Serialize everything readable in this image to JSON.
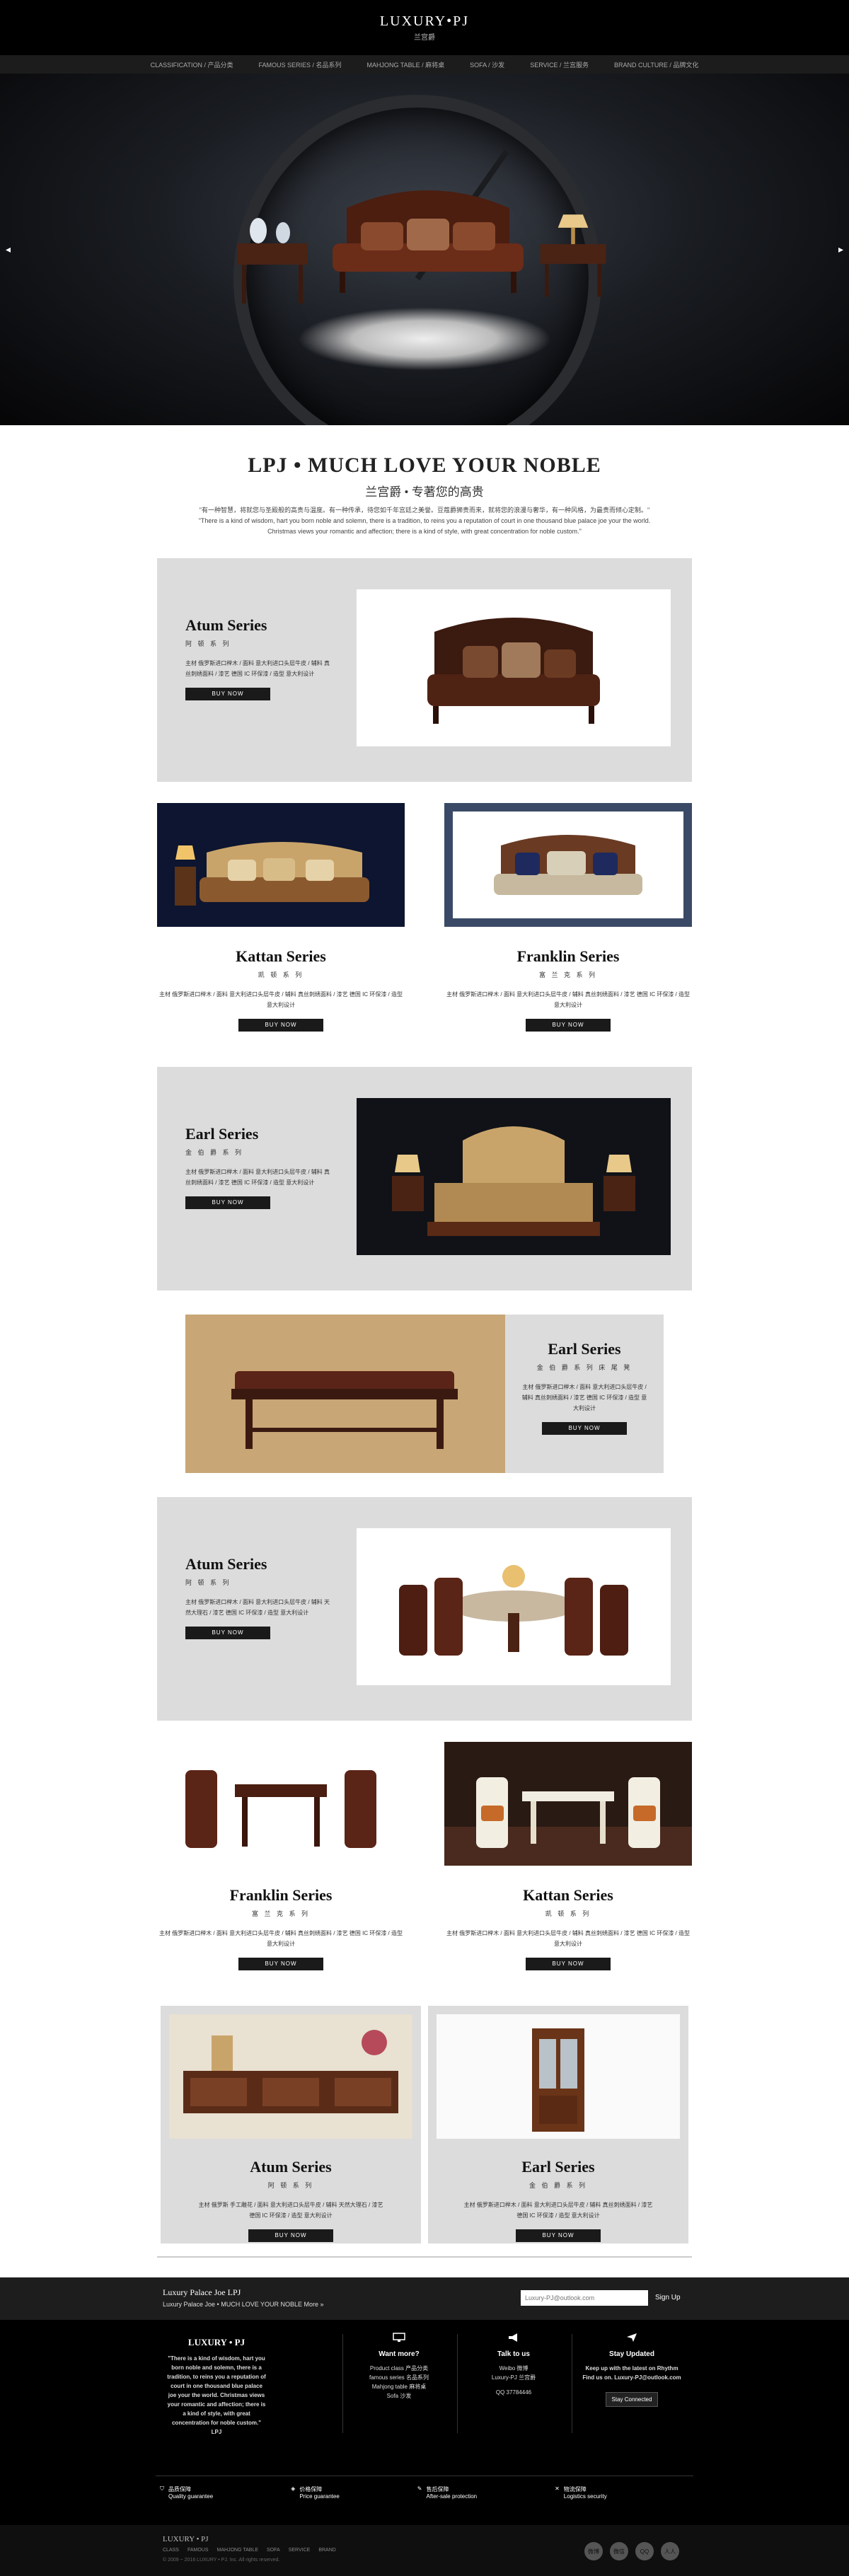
{
  "header": {
    "logo": "LUXURY•PJ",
    "logo_sub": "兰宫爵"
  },
  "nav": [
    "CLASSIFICATION / 产品分类",
    "FAMOUS SERIES / 名品系列",
    "MAHJONG TABLE / 麻将桌",
    "SOFA / 沙发",
    "SERVICE / 兰宫服务",
    "BRAND CULTURE / 品牌文化"
  ],
  "hero": {
    "prev": "◂",
    "next": "▸"
  },
  "intro": {
    "title": "LPJ • MUCH LOVE YOUR NOBLE",
    "subtitle": "兰宫爵 • 专著您的高贵",
    "line1": "\"有一种智慧，将就您与圣殿般的高贵与温度。有一种传承，待您如千年宫廷之美誉。豆蔻爵狮贵而来，就将您的浪漫与奢华，有一种风格，为最贵而倾心定制。\"",
    "line2": "\"There is a kind of wisdom, hart you born noble and solemn, there is a tradition, to reins you a reputation of court in one thousand blue palace joe your the world.",
    "line3": "Christmas views your romantic and affection; there is a kind of style, with great concentration for noble custom.\""
  },
  "series": {
    "s1": {
      "title": "Atum Series",
      "sub": "阿 顿 系 列",
      "desc": "主材 俄罗斯进口榉木 / 面料 意大利进口头层牛皮 / 辅料 真 丝刺绣面料 / 漆艺 德国 IC 环保漆 / 造型 意大利设计",
      "buy": "BUY NOW"
    },
    "s2": {
      "title": "Kattan Series",
      "sub": "凯 顿 系 列",
      "desc": "主材 俄罗斯进口榉木 / 面料 意大利进口头层牛皮 / 辅料 真丝刺绣面料 / 漆艺 德国 IC 环保漆 / 造型 意大利设计",
      "buy": "BUY NOW"
    },
    "s3": {
      "title": "Franklin Series",
      "sub": "富 兰 克 系 列",
      "desc": "主材 俄罗斯进口榉木 / 面料 意大利进口头层牛皮 / 辅料 真丝刺绣面料 / 漆艺 德国 IC 环保漆 / 造型 意大利设计",
      "buy": "BUY NOW"
    },
    "s4": {
      "title": "Earl Series",
      "sub": "金 伯 爵 系 列",
      "desc": "主材 俄罗斯进口榉木 / 面料 意大利进口头层牛皮 / 辅料 真 丝刺绣面料 / 漆艺 德国 IC 环保漆 / 造型 意大利设计",
      "buy": "BUY NOW"
    },
    "s5": {
      "title": "Earl Series",
      "sub": "金 伯 爵 系 列 床 尾 凳",
      "desc": "主材 俄罗斯进口榉木 / 面料 意大利进口头层牛皮 / 辅料 真丝刺绣面料 / 漆艺 德国 IC 环保漆 / 造型 意大利设计",
      "buy": "BUY NOW"
    },
    "s6": {
      "title": "Atum Series",
      "sub": "阿 顿 系 列",
      "desc": "主材 俄罗斯进口榉木 / 面料 意大利进口头层牛皮 / 辅料 天 然大理石 / 漆艺 德国 IC 环保漆 / 造型 意大利设计",
      "buy": "BUY NOW"
    },
    "s7": {
      "title": "Franklin Series",
      "sub": "富 兰 克 系 列",
      "desc": "主材 俄罗斯进口榉木 / 面料 意大利进口头层牛皮 / 辅料 真丝刺绣面料 / 漆艺 德国 IC 环保漆 / 造型 意大利设计",
      "buy": "BUY NOW"
    },
    "s8": {
      "title": "Kattan Series",
      "sub": "凯 顿 系 列",
      "desc": "主材 俄罗斯进口榉木 / 面料 意大利进口头层牛皮 / 辅料 真丝刺绣面料 / 漆艺 德国 IC 环保漆 / 造型 意大利设计",
      "buy": "BUY NOW"
    },
    "s9": {
      "title": "Atum Series",
      "sub": "阿 顿 系 列",
      "desc": "主材 俄罗斯 手工雕花 / 面料 意大利进口头层牛皮 / 辅料 天然大理石 / 漆艺 德国 IC 环保漆 / 造型 意大利设计",
      "buy": "BUY NOW"
    },
    "s10": {
      "title": "Earl Series",
      "sub": "金 伯 爵 系 列",
      "desc": "主材 俄罗斯进口榉木 / 面料 意大利进口头层牛皮 / 辅料 真丝刺绣面料 / 漆艺 德国 IC 环保漆 / 造型 意大利设计",
      "buy": "BUY NOW"
    }
  },
  "subscribe": {
    "title": "Luxury Palace Joe LPJ",
    "text": "Luxury Palace Joe • MUCH LOVE YOUR NOBLE  More »",
    "placeholder": "Luxury-PJ@outlook.com",
    "button": "Sign Up"
  },
  "footer": {
    "brand": {
      "title": "LUXURY • PJ",
      "text": "\"There is a kind of wisdom, hart you born noble and solemn, there is a tradition, to reins you a reputation of court in one thousand blue palace joe your the world. Christmas views your romantic and affection; there is a kind of style, with great concentration for noble custom.\" LPJ"
    },
    "want": {
      "title": "Want more?",
      "l1": "Product class 产品分类",
      "l2": "famous series 名品系列",
      "l3": "Mahjong table 麻将桌",
      "l4": "Sofa 沙发"
    },
    "talk": {
      "title": "Talk to us",
      "l1": "Weibo 微博",
      "l2": "Luxury-PJ 兰宫爵",
      "l3": "QQ 37784446"
    },
    "stay": {
      "title": "Stay Updated",
      "l1": "Keep up with the latest on Rhythm",
      "l2": "Find us on. Luxury-PJ@outlook.com",
      "button": "Stay Connected"
    },
    "guarantees": [
      {
        "t1": "品质保障",
        "t2": "Quality guarantee"
      },
      {
        "t1": "价格保障",
        "t2": "Price guarantee"
      },
      {
        "t1": "售后保障",
        "t2": "After-sale protection"
      },
      {
        "t1": "物流保障",
        "t2": "Logistics security"
      }
    ],
    "bottom_logo": "LUXURY • PJ",
    "links": [
      "CLASS",
      "FAMOUS",
      "MAHJONG TABLE",
      "SOFA",
      "SERVICE",
      "BRAND"
    ],
    "copyright": "© 2009 ~ 2016 LUXURY • PJ. Inc. All rights reserved.",
    "social": [
      "微博",
      "微信",
      "QQ",
      "人人"
    ]
  },
  "colors": {
    "panel": "#dcdcdc",
    "dark": "#1a1a1a",
    "accent": "#5a2a18"
  }
}
